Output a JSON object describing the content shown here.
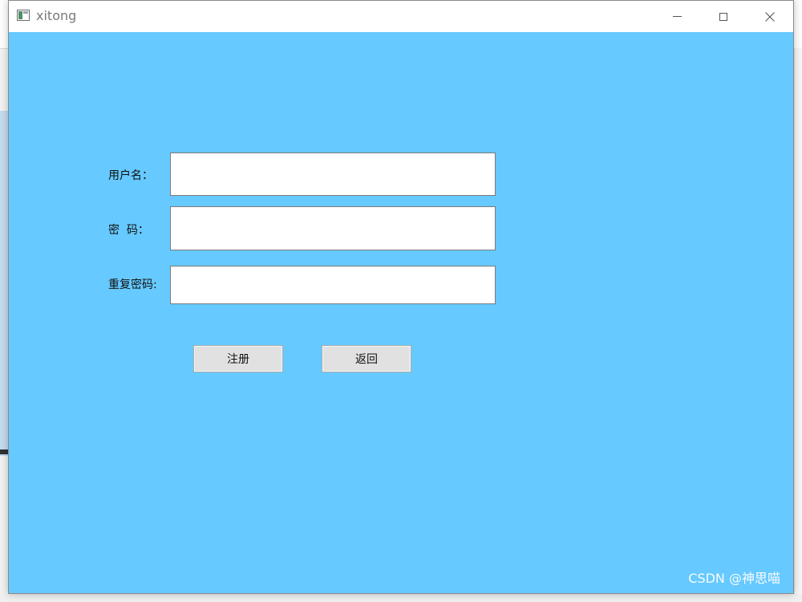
{
  "window": {
    "title": "xitong"
  },
  "form": {
    "username_label": "用户名：",
    "password_label": "密  码：",
    "repeat_label": "重复密码:",
    "username_value": "",
    "password_value": "",
    "repeat_value": ""
  },
  "buttons": {
    "register": "注册",
    "back": "返回"
  },
  "watermark": "CSDN @神思喵",
  "colors": {
    "client_background": "#66c9ff",
    "button_background": "#e1e1e1"
  },
  "icons": {
    "app": "app-window-icon",
    "minimize": "minimize-icon",
    "maximize": "maximize-icon",
    "close": "close-icon"
  }
}
